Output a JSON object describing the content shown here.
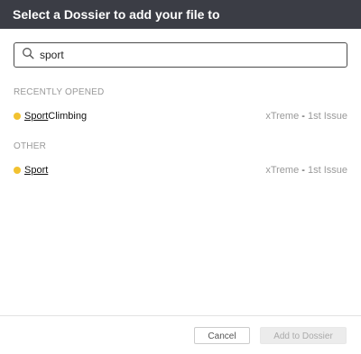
{
  "dialog": {
    "title": "Select a Dossier to add your file to"
  },
  "search": {
    "value": "sport"
  },
  "sections": {
    "recent_label": "RECENTLY OPENED",
    "other_label": "OTHER"
  },
  "recent_items": [
    {
      "title_match": "Sport",
      "title_rest": " Climbing",
      "publication": "xTreme",
      "separator": " - ",
      "issue": "1st Issue",
      "dot_color": "#f2c230"
    }
  ],
  "other_items": [
    {
      "title_match": "Sport",
      "title_rest": "",
      "publication": "xTreme",
      "separator": " - ",
      "issue": "1st Issue",
      "dot_color": "#f2c230"
    }
  ],
  "footer": {
    "cancel_label": "Cancel",
    "add_label": "Add to Dossier"
  }
}
